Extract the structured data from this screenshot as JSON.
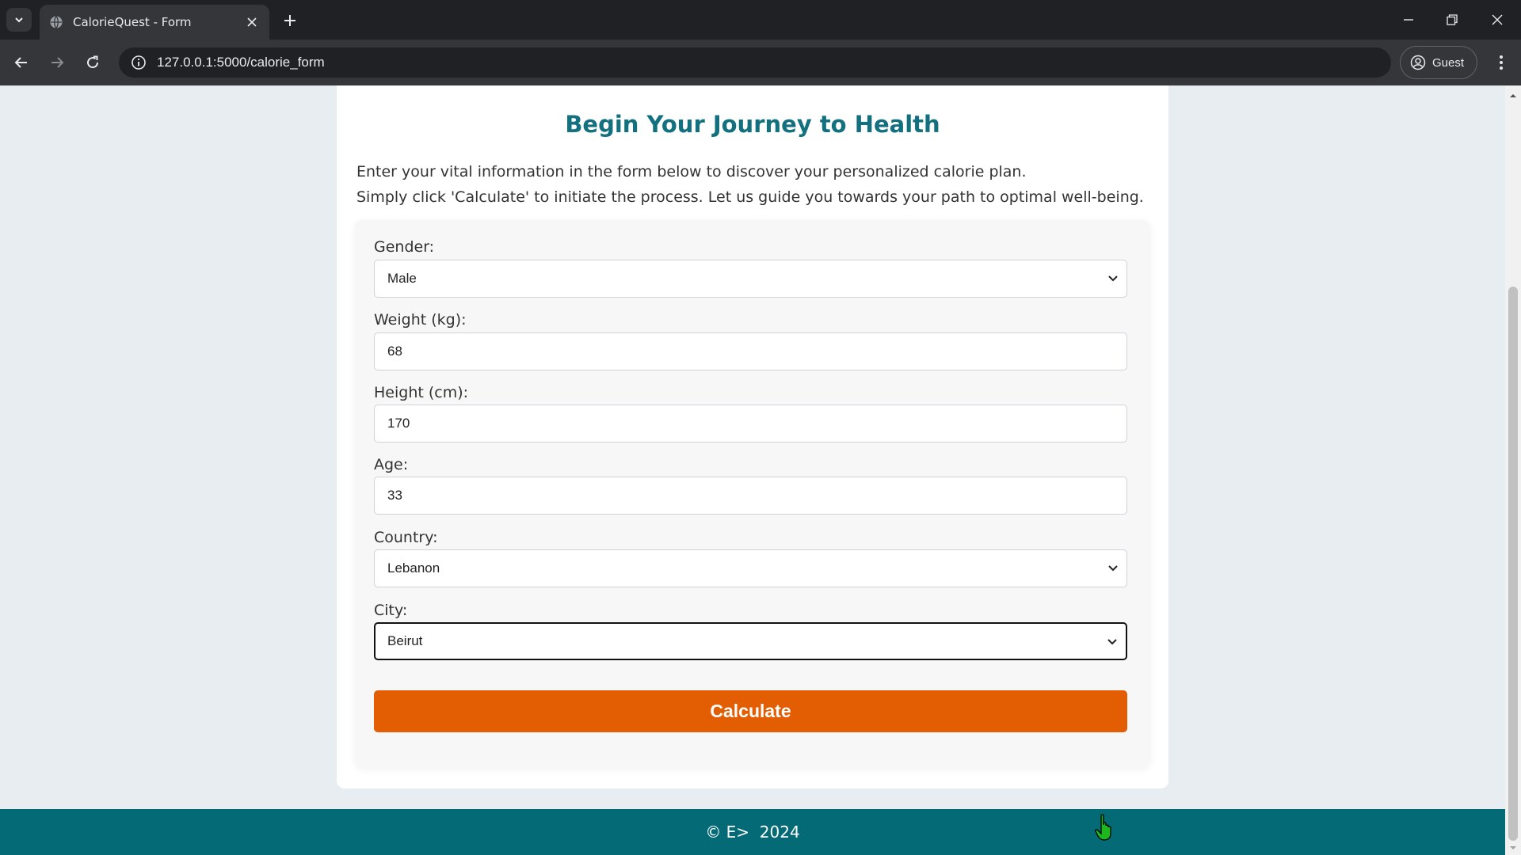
{
  "browser": {
    "tab_title": "CalorieQuest - Form",
    "url": "127.0.0.1:5000/calorie_form",
    "profile_label": "Guest"
  },
  "page": {
    "heading": "Begin Your Journey to Health",
    "intro_line1": "Enter your vital information in the form below to discover your personalized calorie plan.",
    "intro_line2": "Simply click 'Calculate' to initiate the process. Let us guide you towards your path to optimal well-being."
  },
  "form": {
    "gender": {
      "label": "Gender:",
      "value": "Male"
    },
    "weight": {
      "label": "Weight (kg):",
      "value": "68"
    },
    "height": {
      "label": "Height (cm):",
      "value": "170"
    },
    "age": {
      "label": "Age:",
      "value": "33"
    },
    "country": {
      "label": "Country:",
      "value": "Lebanon"
    },
    "city": {
      "label": "City:",
      "value": "Beirut"
    },
    "submit_label": "Calculate"
  },
  "footer": {
    "text": "© E>  2024"
  },
  "colors": {
    "heading": "#12707f",
    "button": "#e35d03",
    "footer": "#046a75"
  }
}
